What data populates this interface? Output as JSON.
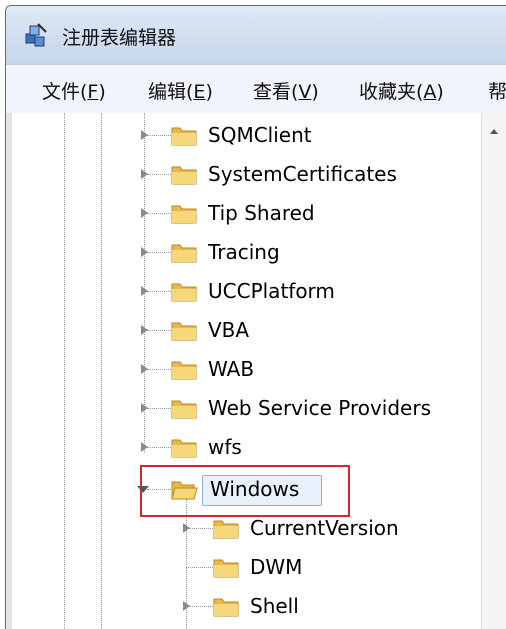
{
  "window": {
    "title": "注册表编辑器",
    "icon": "registry-editor-icon"
  },
  "menu": [
    {
      "text": "文件(",
      "key": "F",
      "close": ")"
    },
    {
      "text": "编辑(",
      "key": "E",
      "close": ")"
    },
    {
      "text": "查看(",
      "key": "V",
      "close": ")"
    },
    {
      "text": "收藏夹(",
      "key": "A",
      "close": ")"
    },
    {
      "text": "帮",
      "key": "",
      "close": ""
    }
  ],
  "tree": {
    "items": [
      {
        "label": "SQMClient",
        "expanded": false
      },
      {
        "label": "SystemCertificates",
        "expanded": false
      },
      {
        "label": "Tip Shared",
        "expanded": false
      },
      {
        "label": "Tracing",
        "expanded": false
      },
      {
        "label": "UCCPlatform",
        "expanded": false
      },
      {
        "label": "VBA",
        "expanded": false
      },
      {
        "label": "WAB",
        "expanded": false
      },
      {
        "label": "Web Service Providers",
        "expanded": false
      },
      {
        "label": "wfs",
        "expanded": false
      },
      {
        "label": "Windows",
        "expanded": true,
        "selected": true,
        "highlighted": true
      },
      {
        "label": "CurrentVersion",
        "expanded": false,
        "child": true
      },
      {
        "label": "DWM",
        "expandable": false,
        "child": true
      },
      {
        "label": "Shell",
        "expanded": false,
        "child": true
      }
    ]
  },
  "colors": {
    "highlight_border": "#d8262b",
    "selection_fill": "#e8f1fb",
    "folder": "#e8b94a"
  }
}
